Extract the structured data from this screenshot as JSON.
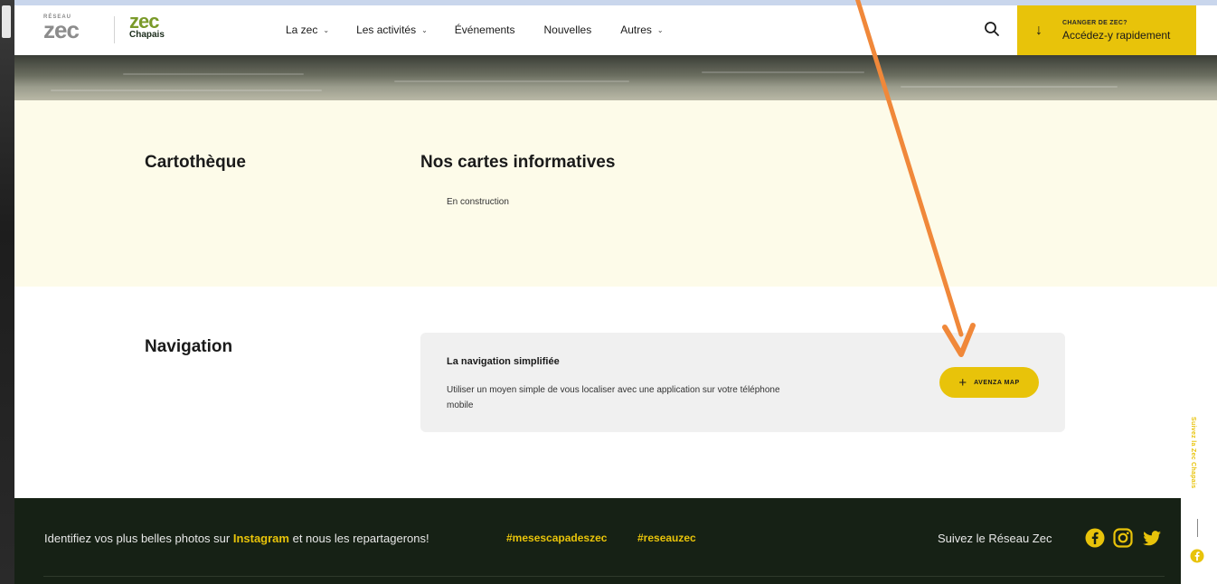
{
  "header": {
    "logo_reseau_small": "RÉSEAU",
    "logo_reseau_big": "zec",
    "logo_zec_big": "zec",
    "logo_zec_sub": "Chapais",
    "nav": [
      {
        "label": "La zec",
        "has_dropdown": true
      },
      {
        "label": "Les activités",
        "has_dropdown": true
      },
      {
        "label": "Événements",
        "has_dropdown": false
      },
      {
        "label": "Nouvelles",
        "has_dropdown": false
      },
      {
        "label": "Autres",
        "has_dropdown": true
      }
    ],
    "search_icon": "search-icon",
    "cta_line1": "CHANGER DE ZEC?",
    "cta_line2": "Accédez-y rapidement"
  },
  "cartotheque": {
    "title": "Cartothèque",
    "subtitle": "Nos cartes informatives",
    "status": "En construction"
  },
  "navigation": {
    "title": "Navigation",
    "card_title": "La navigation simplifiée",
    "card_desc": "Utiliser un moyen simple de vous localiser avec une application sur votre téléphone mobile",
    "button_label": "AVENZA MAP"
  },
  "footer": {
    "text_prefix": "Identifiez vos plus belles photos sur ",
    "text_highlight": "Instagram",
    "text_suffix": " et nous les repartagerons!",
    "hashtag1": "#mesescapadeszec",
    "hashtag2": "#reseauzec",
    "follow_label": "Suivez le Réseau Zec"
  },
  "side": {
    "follow_vertical": "Suivez la Zec Chapais"
  },
  "colors": {
    "accent": "#e8c30a",
    "cream": "#fdfbe9",
    "footer_bg": "#162115",
    "annotation_arrow": "#f0883a"
  }
}
